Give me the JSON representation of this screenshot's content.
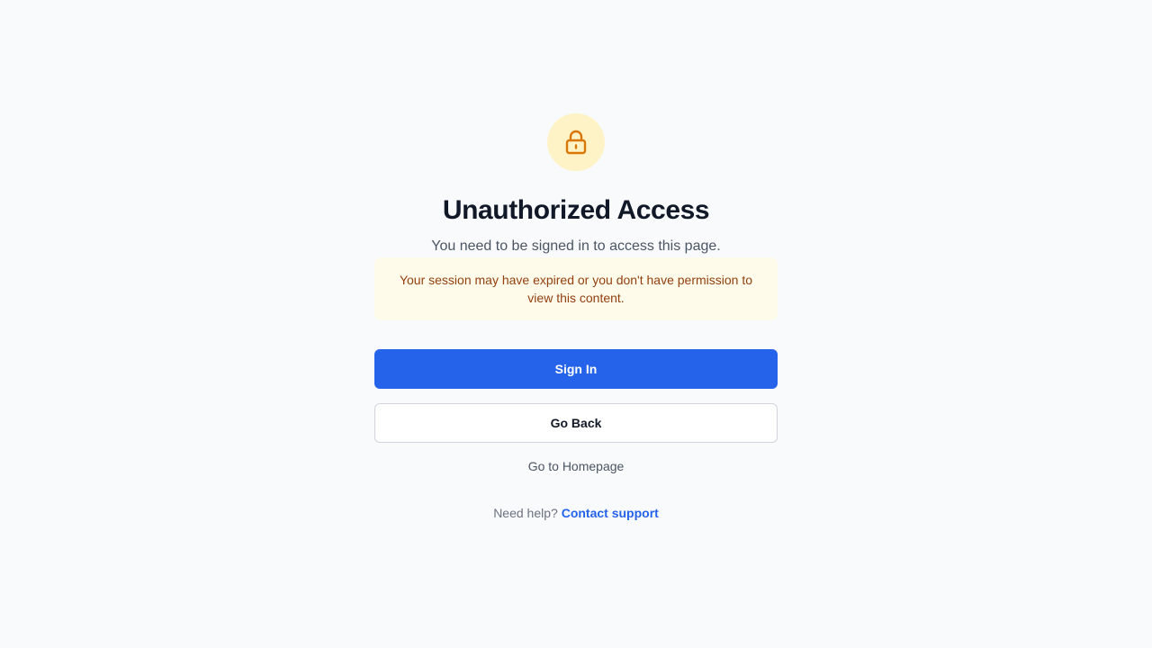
{
  "icon": {
    "name": "lock-icon",
    "color": "#d97706",
    "background": "#fef3c7"
  },
  "heading": {
    "title": "Unauthorized Access",
    "subtitle": "You need to be signed in to access this page."
  },
  "notice": {
    "text": "Your session may have expired or you don't have permission to view this content."
  },
  "actions": {
    "sign_in_label": "Sign In",
    "go_back_label": "Go Back",
    "homepage_label": "Go to Homepage"
  },
  "help": {
    "prompt": "Need help?",
    "link_label": "Contact support"
  },
  "colors": {
    "background": "#f8fafc",
    "primary": "#2563eb",
    "notice_bg": "#fefbeb",
    "notice_text": "#92400e"
  }
}
